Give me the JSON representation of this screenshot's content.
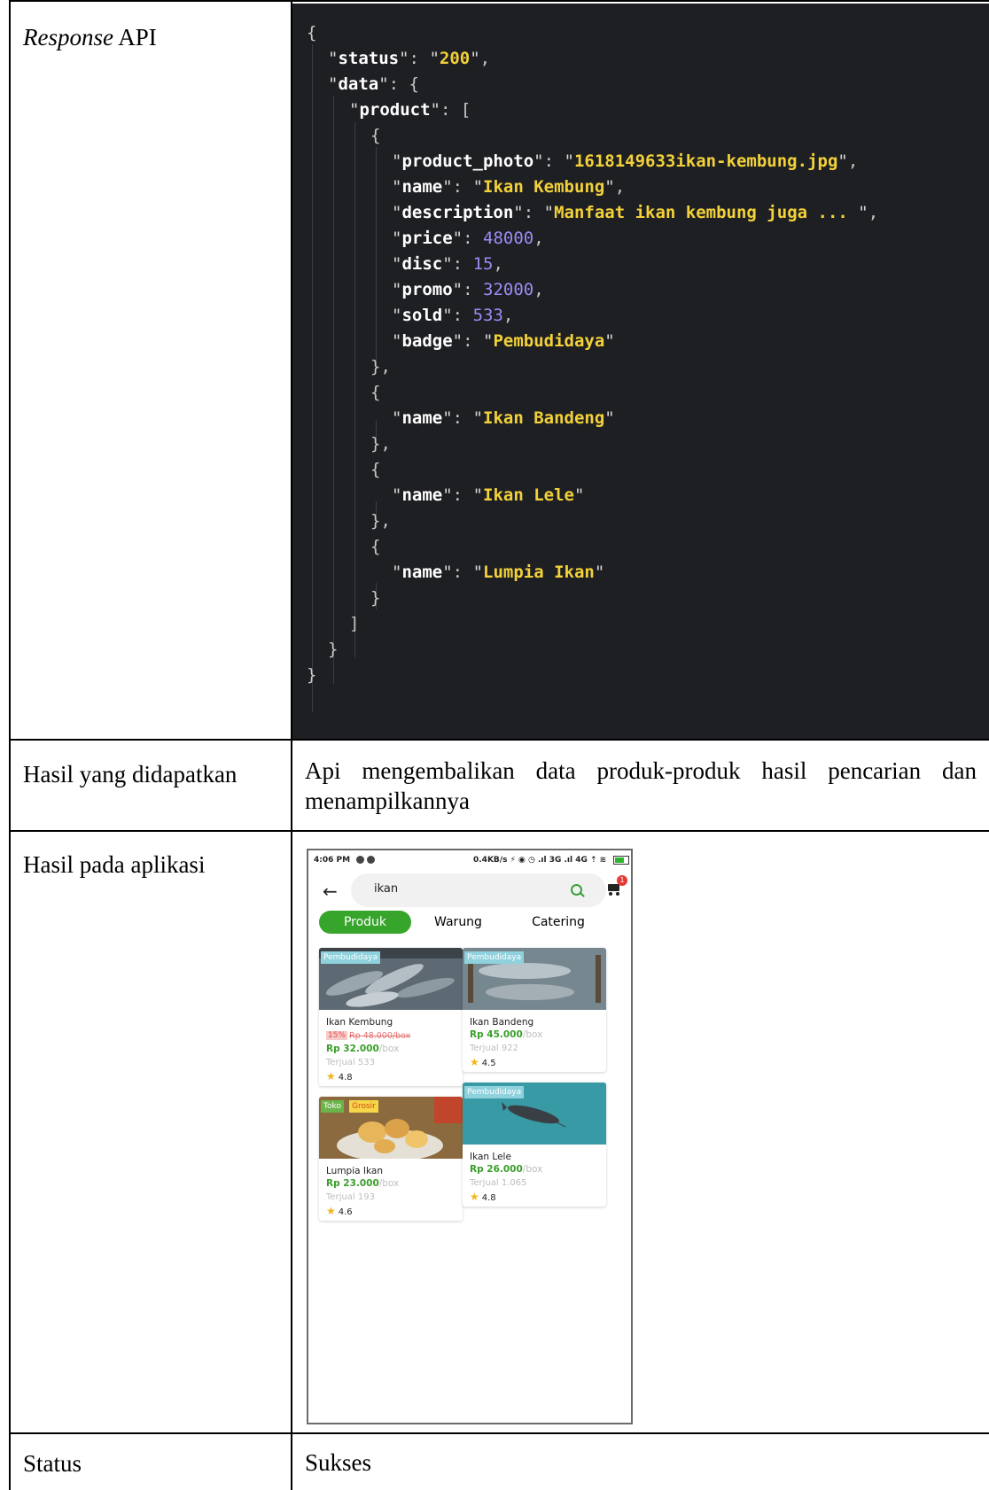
{
  "table": {
    "row1_label_em": "Response",
    "row1_label_rest": " API",
    "row2_label": "Hasil yang didapatkan",
    "row2_value": "Api mengembalikan data produk-produk hasil pencarian dan menampilkannya",
    "row3_label": "Hasil pada aplikasi",
    "row4_label": "Status",
    "row4_value": "Sukses"
  },
  "code": {
    "k_status": "status",
    "v_status": "200",
    "k_data": "data",
    "k_product": "product",
    "k_photo": "product_photo",
    "v_photo": "1618149633ikan-kembung.jpg",
    "k_name": "name",
    "v_name1": "Ikan Kembung",
    "k_desc": "description",
    "v_desc": "Manfaat ikan kembung juga ... ",
    "k_price": "price",
    "v_price": "48000",
    "k_disc": "disc",
    "v_disc": "15",
    "k_promo": "promo",
    "v_promo": "32000",
    "k_sold": "sold",
    "v_sold": "533",
    "k_badge": "badge",
    "v_badge": "Pembudidaya",
    "v_name2": "Ikan Bandeng",
    "v_name3": "Ikan Lele",
    "v_name4": "Lumpia Ikan"
  },
  "app": {
    "status_time": "4:06 PM",
    "status_right": "0.4KB/s  ⚡ ◉ ◷ .ıl 3G .ıl 4G ⇡ ≋",
    "search_value": "ikan",
    "cart_count": "1",
    "tabs": [
      "Produk",
      "Warung",
      "Catering"
    ],
    "products": [
      {
        "tag": "Pembudidaya",
        "name": "Ikan Kembung",
        "disc": "15%",
        "orig": "Rp 48.000/box",
        "price": "Rp 32.000",
        "unit": "/box",
        "sold": "Terjual 533",
        "rating": "4.8"
      },
      {
        "tag": "Pembudidaya",
        "name": "Ikan Bandeng",
        "price": "Rp 45.000",
        "unit": "/box",
        "sold": "Terjual 922",
        "rating": "4.5"
      },
      {
        "tag1": "Toko",
        "tag2": "Grosir",
        "name": "Lumpia Ikan",
        "price": "Rp 23.000",
        "unit": "/box",
        "sold": "Terjual 193",
        "rating": "4.6"
      },
      {
        "tag": "Pembudidaya",
        "name": "Ikan Lele",
        "price": "Rp 26.000",
        "unit": "/box",
        "sold": "Terjual 1.065",
        "rating": "4.8"
      }
    ],
    "colors": {
      "accent": "#37a42c",
      "price": "#3a9e2a",
      "badge": "#e53935",
      "tag": "#8fd1dc"
    }
  }
}
